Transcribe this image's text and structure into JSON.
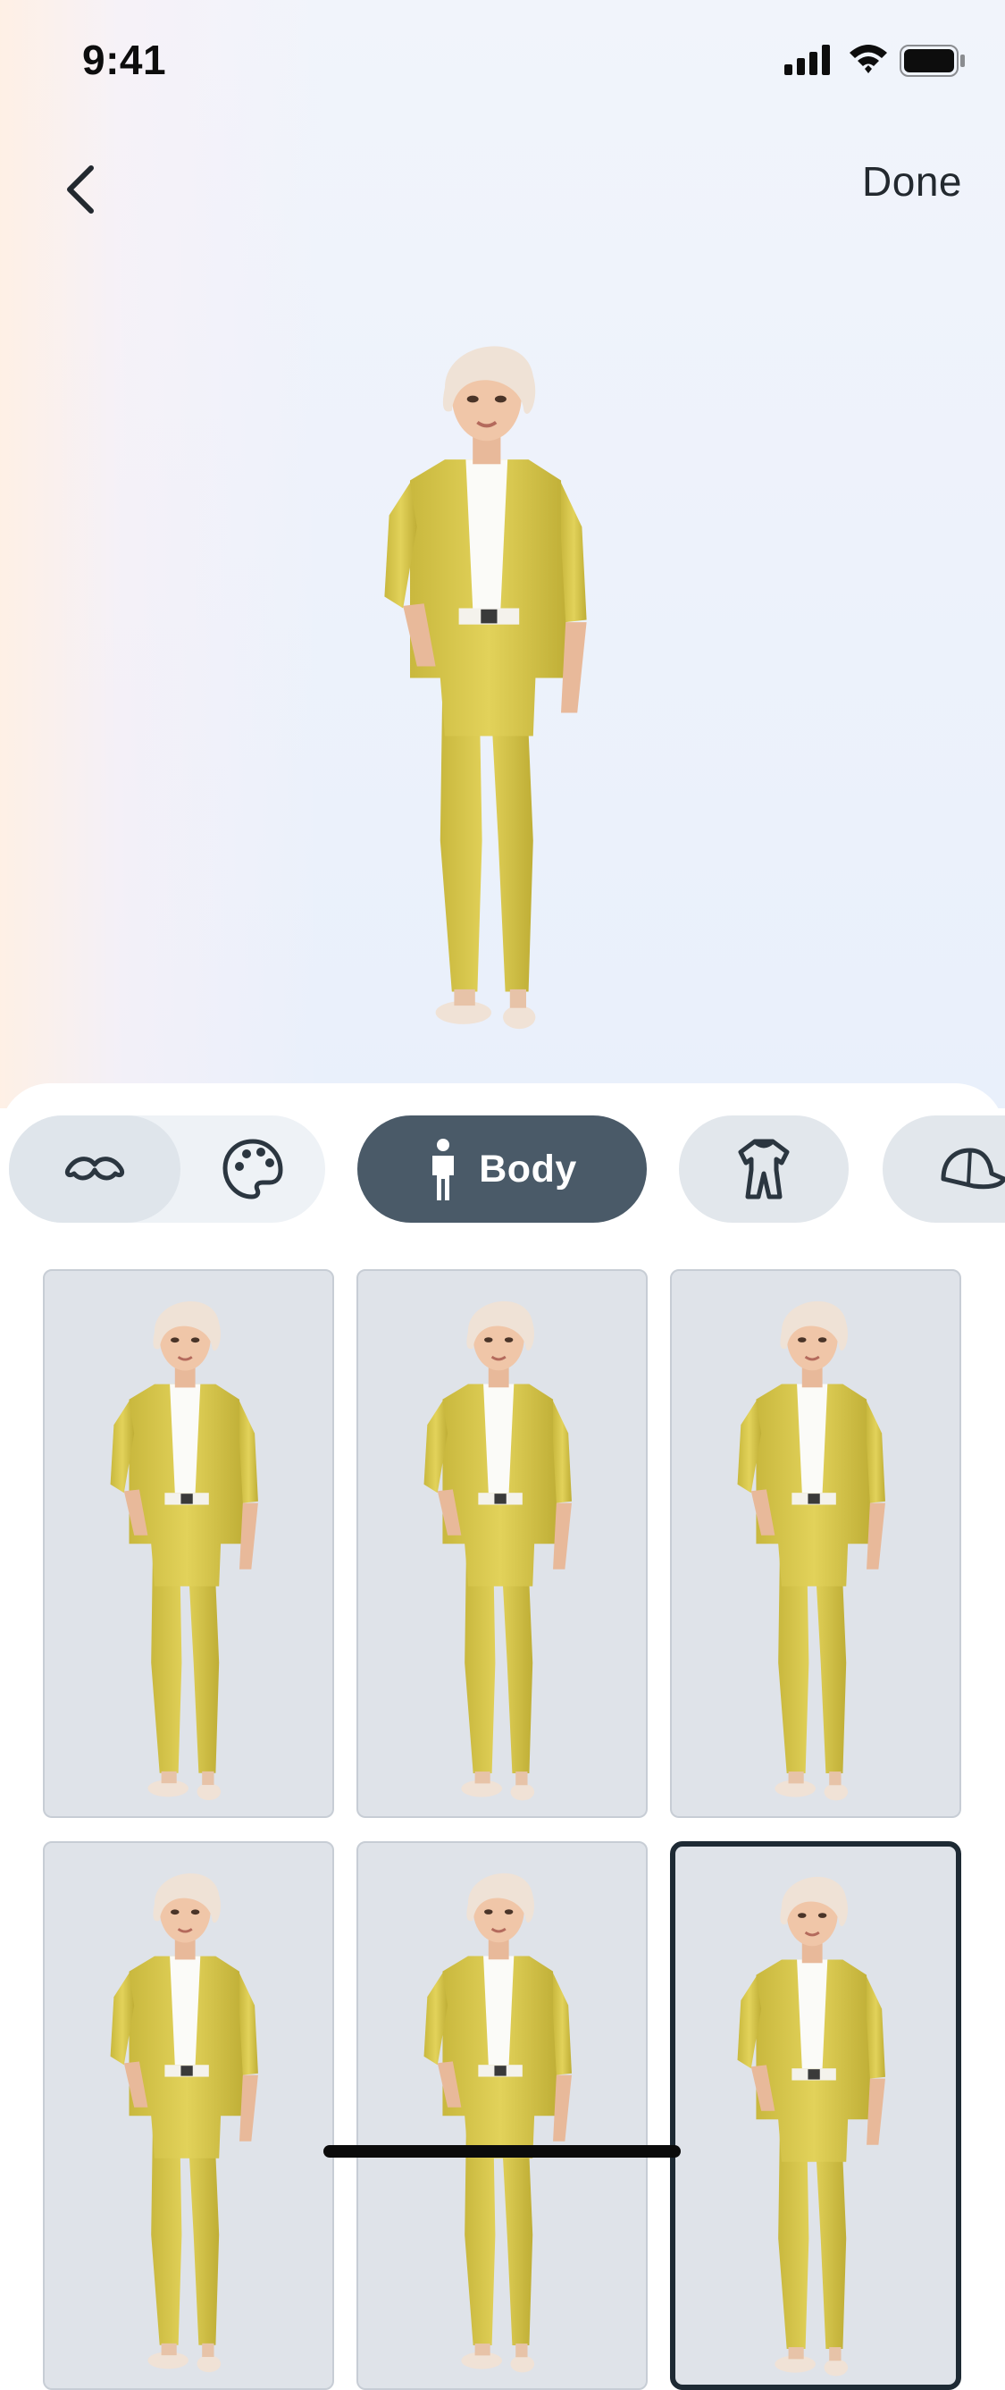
{
  "status_bar": {
    "time": "9:41",
    "signal_icon": "cellular-signal-icon",
    "wifi_icon": "wifi-icon",
    "battery_icon": "battery-icon"
  },
  "nav": {
    "back_icon": "chevron-left-icon",
    "done_label": "Done"
  },
  "categories": [
    {
      "icon": "mustache-icon",
      "selected_in_group": true
    },
    {
      "icon": "palette-icon"
    },
    {
      "icon": "person-icon",
      "label": "Body",
      "active": true
    },
    {
      "icon": "outfit-icon"
    },
    {
      "icon": "cap-icon"
    }
  ],
  "body_options": [
    {
      "shape": "slim",
      "selected": false
    },
    {
      "shape": "curvy",
      "selected": false
    },
    {
      "shape": "medium",
      "selected": false
    },
    {
      "shape": "slim",
      "selected": false
    },
    {
      "shape": "medium",
      "selected": false
    },
    {
      "shape": "medium",
      "selected": true
    }
  ],
  "colors": {
    "active_pill": "#4a5a68",
    "suit": "#d9c94f",
    "tile_bg": "#dfe3e9",
    "selected_border": "#1e2a34"
  }
}
